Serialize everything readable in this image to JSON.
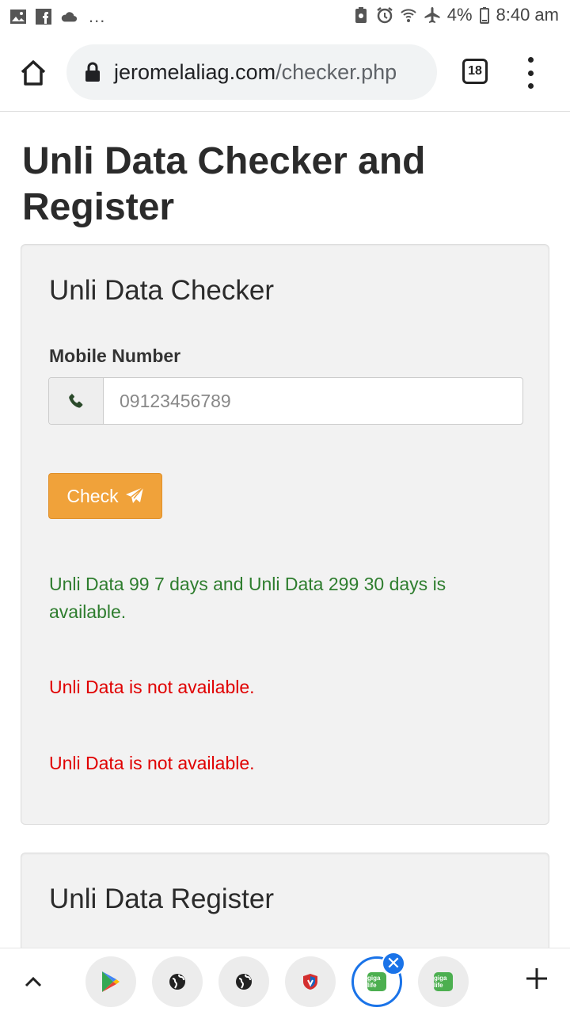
{
  "status_bar": {
    "battery": "4%",
    "time": "8:40 am",
    "overflow": "..."
  },
  "browser": {
    "url_domain": "jeromelaliag.com",
    "url_path": "/checker.php",
    "tab_count": "18"
  },
  "page": {
    "title": "Unli Data Checker and Register",
    "checker": {
      "title": "Unli Data Checker",
      "mobile_label": "Mobile Number",
      "mobile_placeholder": "09123456789",
      "check_button": "Check",
      "messages": [
        "Unli Data 99 7 days and Unli Data 299 30 days is available.",
        "Unli Data is not available.",
        "Unli Data is not available."
      ]
    },
    "register": {
      "title": "Unli Data Register"
    }
  },
  "bottom_bar": {
    "close_symbol": "✕",
    "app_label": "giga life"
  }
}
